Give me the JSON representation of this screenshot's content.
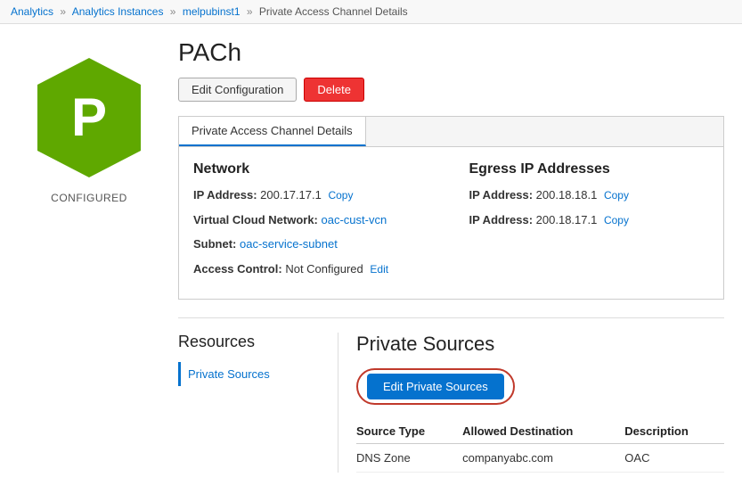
{
  "breadcrumb": {
    "analytics": "Analytics",
    "analytics_instances": "Analytics Instances",
    "instance_name": "melpubinst1",
    "current": "Private Access Channel Details"
  },
  "header": {
    "title": "PACh",
    "hex_letter": "P",
    "hex_color": "#5fa800",
    "status": "CONFIGURED"
  },
  "buttons": {
    "edit_config": "Edit Configuration",
    "delete": "Delete"
  },
  "tab": {
    "label": "Private Access Channel Details"
  },
  "network": {
    "title": "Network",
    "ip_address_label": "IP Address:",
    "ip_address_value": "200.17.17.1",
    "ip_copy": "Copy",
    "vcn_label": "Virtual Cloud Network:",
    "vcn_link": "oac-cust-vcn",
    "subnet_label": "Subnet:",
    "subnet_link": "oac-service-subnet",
    "access_control_label": "Access Control:",
    "access_control_value": "Not Configured",
    "access_control_edit": "Edit"
  },
  "egress": {
    "title": "Egress IP Addresses",
    "ip1_label": "IP Address:",
    "ip1_value": "200.18.18.1",
    "ip1_copy": "Copy",
    "ip2_label": "IP Address:",
    "ip2_value": "200.18.17.1",
    "ip2_copy": "Copy"
  },
  "resources": {
    "title": "Resources",
    "items": [
      {
        "label": "Private Sources"
      }
    ]
  },
  "private_sources": {
    "title": "Private Sources",
    "edit_button": "Edit Private Sources",
    "table": {
      "headers": [
        "Source Type",
        "Allowed Destination",
        "Description"
      ],
      "rows": [
        {
          "source_type": "DNS Zone",
          "allowed_destination": "companyabc.com",
          "description": "OAC"
        }
      ]
    }
  }
}
